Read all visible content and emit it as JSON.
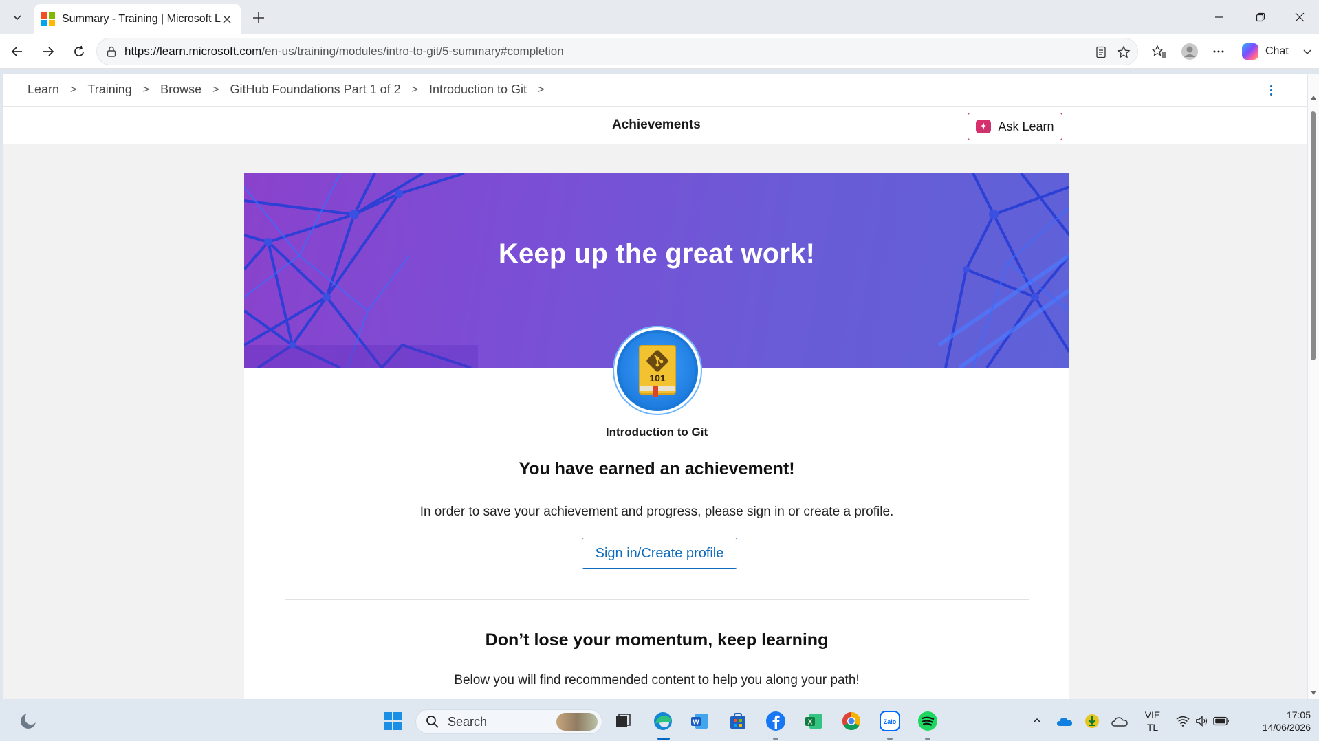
{
  "browser": {
    "tab_title": "Summary - Training | Microsoft Learn",
    "url_host": "https://learn.microsoft.com",
    "url_path": "/en-us/training/modules/intro-to-git/5-summary#completion",
    "chat_label": "Chat"
  },
  "breadcrumbs": [
    "Learn",
    "Training",
    "Browse",
    "GitHub Foundations Part 1 of 2",
    "Introduction to Git"
  ],
  "subheader": {
    "title": "Achievements",
    "ask_learn": "Ask Learn"
  },
  "achievement": {
    "hero_title": "Keep up the great work!",
    "badge_text": "101",
    "module_name": "Introduction to Git",
    "earned_heading": "You have earned an achievement!",
    "description": "In order to save your achievement and progress, please sign in or create a profile.",
    "signin_button": "Sign in/Create profile",
    "momentum_heading": "Don’t lose your momentum, keep learning",
    "below_text": "Below you will find recommended content to help you along your path!"
  },
  "taskbar": {
    "search_label": "Search",
    "lang_line1": "VIE",
    "lang_line2": "TL",
    "time": "17:05",
    "date": "14/06/2026"
  },
  "colors": {
    "accent_blue": "#0f6cbd",
    "ask_learn_border": "#c43670",
    "hero_start": "#8a42cc",
    "hero_end": "#5e62d8"
  }
}
